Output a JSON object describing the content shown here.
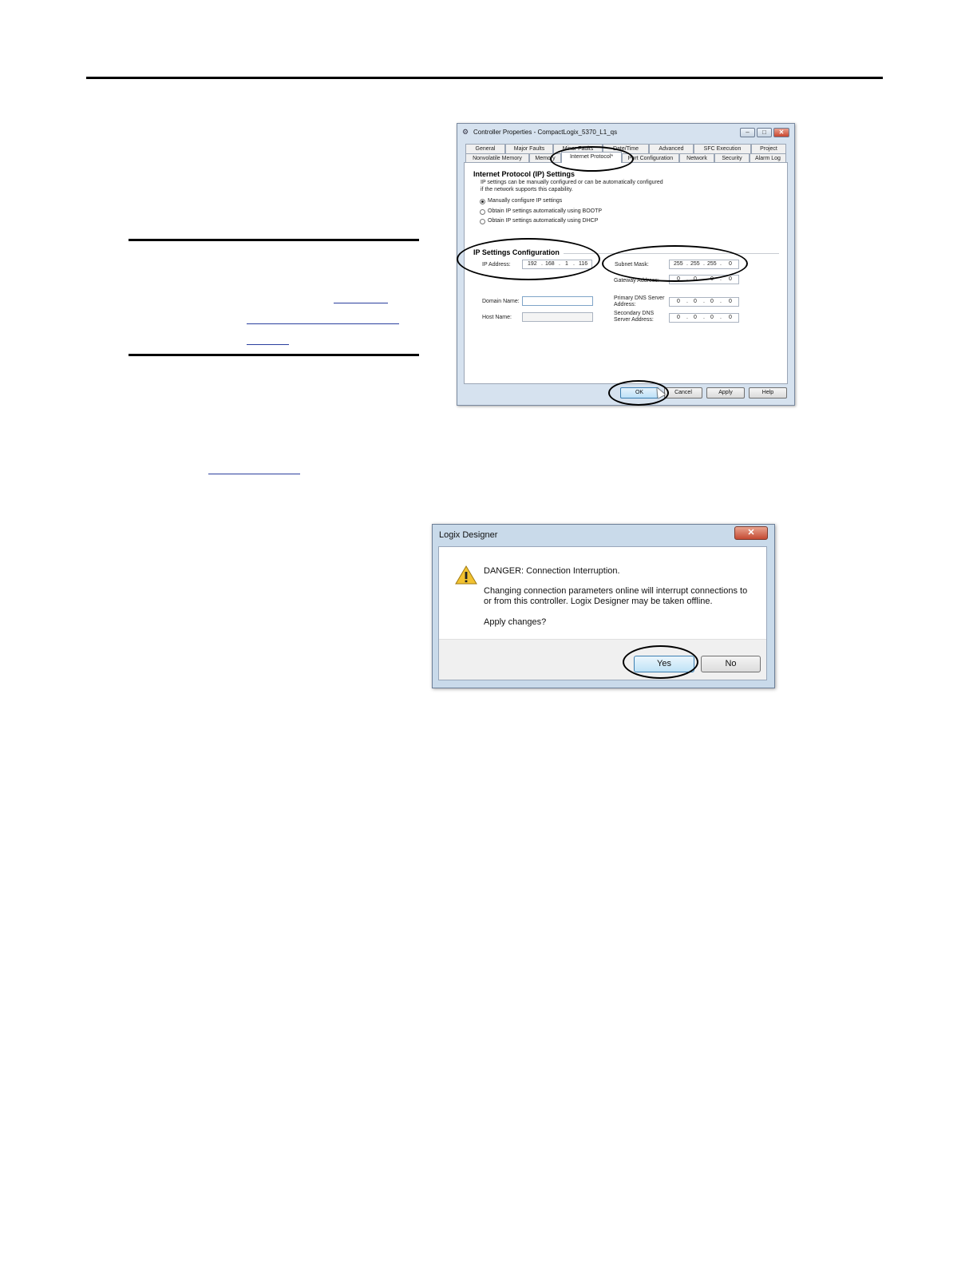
{
  "dialog1": {
    "title": "Controller Properties - CompactLogix_5370_L1_qs",
    "tabs_row1": [
      "General",
      "Major Faults",
      "Minor Faults",
      "Date/Time",
      "Advanced",
      "SFC Execution",
      "Project"
    ],
    "tabs_row2": [
      "Nonvolatile Memory",
      "Memory",
      "Internet Protocol*",
      "Port Configuration",
      "Network",
      "Security",
      "Alarm Log"
    ],
    "section_title": "Internet Protocol (IP) Settings",
    "description_line1": "IP settings can be manually configured or can be automatically configured",
    "description_line2": "if the network supports this capability.",
    "radio_options": [
      {
        "label": "Manually configure IP settings",
        "selected": true
      },
      {
        "label": "Obtain IP settings automatically using BOOTP",
        "selected": false
      },
      {
        "label": "Obtain IP settings automatically using DHCP",
        "selected": false
      }
    ],
    "config_title": "IP Settings Configuration",
    "ip_address_label": "IP Address:",
    "ip_address": [
      "192",
      "168",
      "1",
      "116"
    ],
    "subnet_mask_label": "Subnet Mask:",
    "subnet_mask": [
      "255",
      "255",
      "255",
      "0"
    ],
    "gateway_label": "Gateway Address:",
    "gateway": [
      "0",
      "0",
      "0",
      "0"
    ],
    "domain_label": "Domain Name:",
    "host_label": "Host Name:",
    "primary_dns_label_1": "Primary DNS Server",
    "primary_dns_label_2": "Address:",
    "primary_dns": [
      "0",
      "0",
      "0",
      "0"
    ],
    "secondary_dns_label_1": "Secondary DNS",
    "secondary_dns_label_2": "Server Address:",
    "secondary_dns": [
      "0",
      "0",
      "0",
      "0"
    ],
    "buttons": {
      "ok": "OK",
      "cancel": "Cancel",
      "apply": "Apply",
      "help": "Help"
    },
    "minimize_glyph": "–",
    "maximize_glyph": "□",
    "close_glyph": "✕"
  },
  "dialog2": {
    "title": "Logix Designer",
    "close_glyph": "✕",
    "heading": "DANGER: Connection Interruption.",
    "message_line1": "Changing connection parameters online will interrupt connections to",
    "message_line2": "or from this controller.  Logix Designer may be taken offline.",
    "question": "Apply changes?",
    "buttons": {
      "yes": "Yes",
      "no": "No"
    }
  },
  "colors": {
    "link": "#2a3f9e",
    "window_frame": "#d6e2ef",
    "close_red": "#c44a33",
    "warning_yellow": "#f2c230"
  },
  "icons": [
    "warning-icon",
    "controller-app-icon",
    "close-icon",
    "minimize-icon",
    "maximize-icon",
    "cursor-pointer-icon"
  ]
}
